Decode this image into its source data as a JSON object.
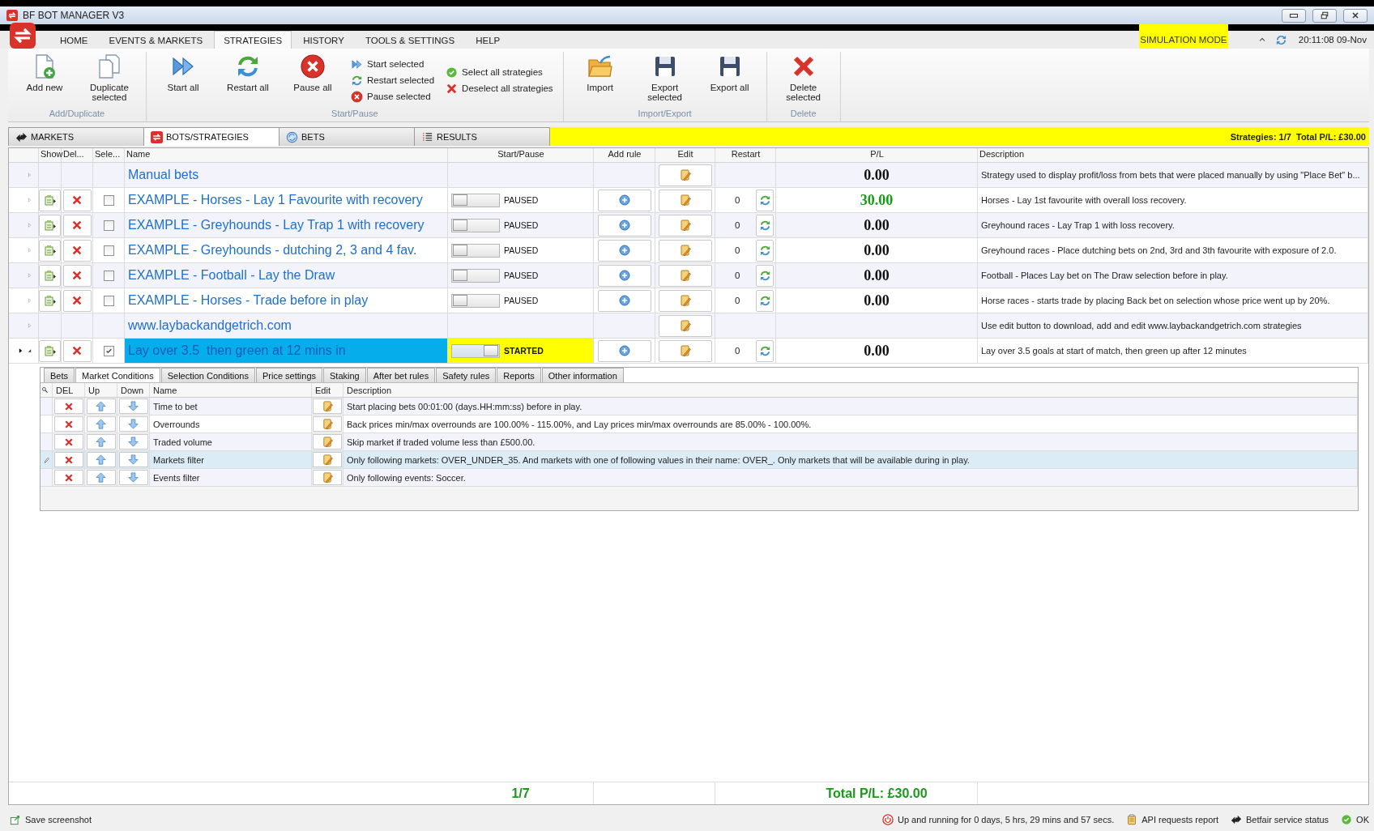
{
  "window": {
    "title": "BF BOT MANAGER V3"
  },
  "ribbon_tabs": [
    {
      "label": "HOME",
      "selected": false
    },
    {
      "label": "EVENTS & MARKETS",
      "selected": false
    },
    {
      "label": "STRATEGIES",
      "selected": true
    },
    {
      "label": "HISTORY",
      "selected": false
    },
    {
      "label": "TOOLS & SETTINGS",
      "selected": false
    },
    {
      "label": "HELP",
      "selected": false
    }
  ],
  "mode_badge": "SIMULATION MODE",
  "clock": "20:11:08 09-Nov",
  "ribbon_groups": [
    {
      "label": "Add/Duplicate",
      "items": [
        {
          "kind": "large",
          "label": "Add new"
        },
        {
          "kind": "large",
          "label": "Duplicate selected"
        }
      ]
    },
    {
      "label": "Start/Pause",
      "items": [
        {
          "kind": "large",
          "label": "Start all"
        },
        {
          "kind": "large",
          "label": "Restart all"
        },
        {
          "kind": "large",
          "label": "Pause all"
        },
        {
          "kind": "stack",
          "items": [
            "Start selected",
            "Restart selected",
            "Pause selected"
          ]
        },
        {
          "kind": "stack",
          "items": [
            "Select all strategies",
            "Deselect all strategies"
          ]
        }
      ]
    },
    {
      "label": "Import/Export",
      "items": [
        {
          "kind": "large",
          "label": "Import"
        },
        {
          "kind": "large",
          "label": "Export selected"
        },
        {
          "kind": "large",
          "label": "Export all"
        }
      ]
    },
    {
      "label": "Delete",
      "items": [
        {
          "kind": "large",
          "label": "Delete selected"
        }
      ]
    }
  ],
  "view_tabs": [
    {
      "label": "MARKETS",
      "selected": false
    },
    {
      "label": "BOTS/STRATEGIES",
      "selected": true
    },
    {
      "label": "BETS",
      "selected": false
    },
    {
      "label": "RESULTS",
      "selected": false
    }
  ],
  "summary": "Strategies: 1/7  Total P/L: £30.00",
  "table": {
    "columns": [
      "Show",
      "Del...",
      "Sele...",
      "Name",
      "Start/Pause",
      "Add rule",
      "Edit",
      "Restart",
      "P/L",
      "Description"
    ],
    "rows": [
      {
        "kind": "group",
        "name": "Manual bets",
        "expanded": false,
        "selected": false,
        "pl": "0.00",
        "profit": false,
        "description": "Strategy used to display profit/loss from bets that were placed manually by using \"Place Bet\" b..."
      },
      {
        "kind": "strategy",
        "name": "EXAMPLE - Horses - Lay 1 Favourite with recovery",
        "expanded": false,
        "selected": false,
        "checked": false,
        "started": false,
        "state": "PAUSED",
        "restarts": "0",
        "pl": "30.00",
        "profit": true,
        "description": "Horses - Lay 1st favourite with overall loss recovery."
      },
      {
        "kind": "strategy",
        "name": "EXAMPLE - Greyhounds - Lay Trap 1 with recovery",
        "expanded": false,
        "selected": false,
        "checked": false,
        "started": false,
        "state": "PAUSED",
        "restarts": "0",
        "pl": "0.00",
        "profit": false,
        "description": "Greyhound races - Lay Trap 1 with loss recovery."
      },
      {
        "kind": "strategy",
        "name": "EXAMPLE - Greyhounds - dutching 2, 3 and 4 fav.",
        "expanded": false,
        "selected": false,
        "checked": false,
        "started": false,
        "state": "PAUSED",
        "restarts": "0",
        "pl": "0.00",
        "profit": false,
        "description": "Greyhound races - Place dutching bets on 2nd, 3rd and 3th favourite with exposure of 2.0."
      },
      {
        "kind": "strategy",
        "name": "EXAMPLE - Football - Lay the Draw",
        "expanded": false,
        "selected": false,
        "checked": false,
        "started": false,
        "state": "PAUSED",
        "restarts": "0",
        "pl": "0.00",
        "profit": false,
        "description": "Football - Places Lay bet on The Draw selection before in play."
      },
      {
        "kind": "strategy",
        "name": "EXAMPLE - Horses - Trade before in play",
        "expanded": false,
        "selected": false,
        "checked": false,
        "started": false,
        "state": "PAUSED",
        "restarts": "0",
        "pl": "0.00",
        "profit": false,
        "description": "Horse races - starts trade by placing Back bet on selection whose price went up by 20%."
      },
      {
        "kind": "group",
        "name": "www.laybackandgetrich.com",
        "expanded": false,
        "selected": false,
        "description": "Use edit button to download, add and edit www.laybackandgetrich.com strategies"
      },
      {
        "kind": "strategy",
        "name": "Lay over 3.5  then green at 12 mins in",
        "expanded": true,
        "selected": true,
        "checked": true,
        "started": true,
        "state": "STARTED",
        "restarts": "0",
        "pl": "0.00",
        "profit": false,
        "description": "Lay over 3.5 goals at start of match, then green up after 12 minutes",
        "details": {
          "tabs": [
            {
              "label": "Bets",
              "selected": false
            },
            {
              "label": "Market Conditions",
              "selected": true
            },
            {
              "label": "Selection Conditions",
              "selected": false
            },
            {
              "label": "Price settings",
              "selected": false
            },
            {
              "label": "Staking",
              "selected": false
            },
            {
              "label": "After bet rules",
              "selected": false
            },
            {
              "label": "Safety rules",
              "selected": false
            },
            {
              "label": "Reports",
              "selected": false
            },
            {
              "label": "Other information",
              "selected": false
            }
          ],
          "columns": [
            "DEL",
            "Up",
            "Down",
            "Name",
            "Edit",
            "Description"
          ],
          "rows": [
            {
              "name": "Time to bet",
              "description": "Start placing bets 00:01:00 (days.HH:mm:ss) before in play.",
              "selected": false
            },
            {
              "name": "Overrounds",
              "description": "Back prices min/max overrounds are 100.00% - 115.00%, and Lay prices min/max overrounds are 85.00% - 100.00%.",
              "selected": false
            },
            {
              "name": "Traded volume",
              "description": "Skip market if traded volume less than £500.00.",
              "selected": false
            },
            {
              "name": "Markets filter",
              "description": "Only following markets: OVER_UNDER_35. And markets with one of following values in their name: OVER_. Only markets that will be available during in play.",
              "selected": true
            },
            {
              "name": "Events filter",
              "description": "Only following events: Soccer.",
              "selected": false
            }
          ]
        }
      }
    ]
  },
  "footer": {
    "count": "1/7",
    "total": "Total P/L: £30.00"
  },
  "status_bar": {
    "left": "Save screenshot",
    "items": [
      "Up and running for 0 days, 5 hrs, 29 mins and 57 secs.",
      "API requests report",
      "Betfair service status",
      "OK"
    ]
  }
}
